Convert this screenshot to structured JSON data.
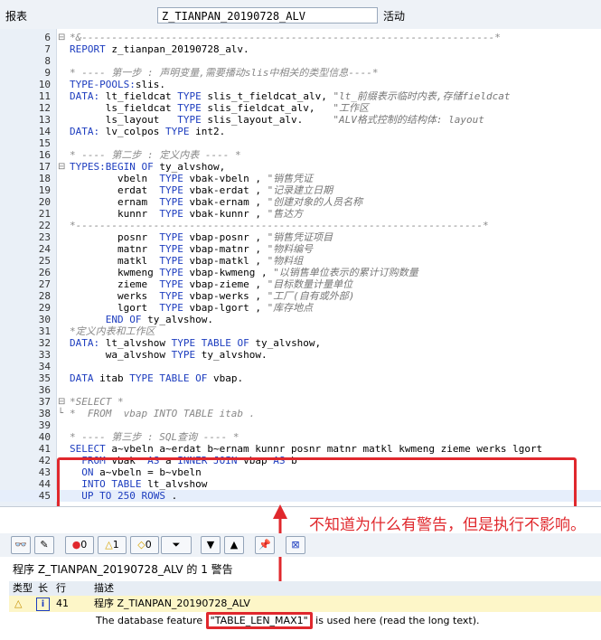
{
  "header": {
    "label": "报表",
    "program": "Z_TIANPAN_20190728_ALV",
    "status": "活动"
  },
  "code_lines": [
    {
      "n": "6",
      "fold": "⊟",
      "segs": [
        {
          "t": "*&---------------------------------------------------------------------*",
          "c": "cmt"
        }
      ]
    },
    {
      "n": "7",
      "segs": [
        {
          "t": "REPORT ",
          "c": "kw"
        },
        {
          "t": "z_tianpan_20190728_alv.",
          "c": ""
        }
      ]
    },
    {
      "n": "8",
      "segs": []
    },
    {
      "n": "9",
      "segs": [
        {
          "t": "* ---- 第一步 : 声明变量,需要播动slis中相关的类型信息----*",
          "c": "cmt"
        }
      ]
    },
    {
      "n": "10",
      "segs": [
        {
          "t": "TYPE-POOLS:",
          "c": "kw"
        },
        {
          "t": "slis.",
          "c": ""
        }
      ]
    },
    {
      "n": "11",
      "segs": [
        {
          "t": "DATA: ",
          "c": "kw"
        },
        {
          "t": "lt_fieldcat ",
          "c": ""
        },
        {
          "t": "TYPE ",
          "c": "kw"
        },
        {
          "t": "slis_t_fieldcat_alv, ",
          "c": ""
        },
        {
          "t": "\"lt_前缀表示临时内表,存储fieldcat",
          "c": "str"
        }
      ]
    },
    {
      "n": "12",
      "segs": [
        {
          "t": "      ls_fieldcat ",
          "c": ""
        },
        {
          "t": "TYPE ",
          "c": "kw"
        },
        {
          "t": "slis_fieldcat_alv,   ",
          "c": ""
        },
        {
          "t": "\"工作区",
          "c": "str"
        }
      ]
    },
    {
      "n": "13",
      "segs": [
        {
          "t": "      ls_layout   ",
          "c": ""
        },
        {
          "t": "TYPE ",
          "c": "kw"
        },
        {
          "t": "slis_layout_alv.     ",
          "c": ""
        },
        {
          "t": "\"ALV格式控制的结构体: layout",
          "c": "str"
        }
      ]
    },
    {
      "n": "14",
      "segs": [
        {
          "t": "DATA: ",
          "c": "kw"
        },
        {
          "t": "lv_colpos ",
          "c": ""
        },
        {
          "t": "TYPE ",
          "c": "kw"
        },
        {
          "t": "int2.",
          "c": ""
        }
      ]
    },
    {
      "n": "15",
      "segs": []
    },
    {
      "n": "16",
      "segs": [
        {
          "t": "* ---- 第二步 : 定义内表 ---- *",
          "c": "cmt"
        }
      ]
    },
    {
      "n": "17",
      "fold": "⊟",
      "segs": [
        {
          "t": "TYPES:BEGIN OF ",
          "c": "kw"
        },
        {
          "t": "ty_alvshow,",
          "c": ""
        }
      ]
    },
    {
      "n": "18",
      "segs": [
        {
          "t": "        vbeln  ",
          "c": ""
        },
        {
          "t": "TYPE ",
          "c": "kw"
        },
        {
          "t": "vbak-vbeln , ",
          "c": ""
        },
        {
          "t": "\"销售凭证",
          "c": "str"
        }
      ]
    },
    {
      "n": "19",
      "segs": [
        {
          "t": "        erdat  ",
          "c": ""
        },
        {
          "t": "TYPE ",
          "c": "kw"
        },
        {
          "t": "vbak-erdat , ",
          "c": ""
        },
        {
          "t": "\"记录建立日期",
          "c": "str"
        }
      ]
    },
    {
      "n": "20",
      "segs": [
        {
          "t": "        ernam  ",
          "c": ""
        },
        {
          "t": "TYPE ",
          "c": "kw"
        },
        {
          "t": "vbak-ernam , ",
          "c": ""
        },
        {
          "t": "\"创建对象的人员名称",
          "c": "str"
        }
      ]
    },
    {
      "n": "21",
      "segs": [
        {
          "t": "        kunnr  ",
          "c": ""
        },
        {
          "t": "TYPE ",
          "c": "kw"
        },
        {
          "t": "vbak-kunnr , ",
          "c": ""
        },
        {
          "t": "\"售达方",
          "c": "str"
        }
      ]
    },
    {
      "n": "22",
      "segs": [
        {
          "t": "*--------------------------------------------------------------------*",
          "c": "cmt"
        }
      ]
    },
    {
      "n": "23",
      "segs": [
        {
          "t": "        posnr  ",
          "c": ""
        },
        {
          "t": "TYPE ",
          "c": "kw"
        },
        {
          "t": "vbap-posnr , ",
          "c": ""
        },
        {
          "t": "\"销售凭证项目",
          "c": "str"
        }
      ]
    },
    {
      "n": "24",
      "segs": [
        {
          "t": "        matnr  ",
          "c": ""
        },
        {
          "t": "TYPE ",
          "c": "kw"
        },
        {
          "t": "vbap-matnr , ",
          "c": ""
        },
        {
          "t": "\"物料编号",
          "c": "str"
        }
      ]
    },
    {
      "n": "25",
      "segs": [
        {
          "t": "        matkl  ",
          "c": ""
        },
        {
          "t": "TYPE ",
          "c": "kw"
        },
        {
          "t": "vbap-matkl , ",
          "c": ""
        },
        {
          "t": "\"物料组",
          "c": "str"
        }
      ]
    },
    {
      "n": "26",
      "segs": [
        {
          "t": "        kwmeng ",
          "c": ""
        },
        {
          "t": "TYPE ",
          "c": "kw"
        },
        {
          "t": "vbap-kwmeng , ",
          "c": ""
        },
        {
          "t": "\"以销售单位表示的累计订购数量",
          "c": "str"
        }
      ]
    },
    {
      "n": "27",
      "segs": [
        {
          "t": "        zieme  ",
          "c": ""
        },
        {
          "t": "TYPE ",
          "c": "kw"
        },
        {
          "t": "vbap-zieme , ",
          "c": ""
        },
        {
          "t": "\"目标数量计量单位",
          "c": "str"
        }
      ]
    },
    {
      "n": "28",
      "segs": [
        {
          "t": "        werks  ",
          "c": ""
        },
        {
          "t": "TYPE ",
          "c": "kw"
        },
        {
          "t": "vbap-werks , ",
          "c": ""
        },
        {
          "t": "\"工厂(自有或外部)",
          "c": "str"
        }
      ]
    },
    {
      "n": "29",
      "segs": [
        {
          "t": "        lgort  ",
          "c": ""
        },
        {
          "t": "TYPE ",
          "c": "kw"
        },
        {
          "t": "vbap-lgort , ",
          "c": ""
        },
        {
          "t": "\"库存地点",
          "c": "str"
        }
      ]
    },
    {
      "n": "30",
      "segs": [
        {
          "t": "      END OF ",
          "c": "kw"
        },
        {
          "t": "ty_alvshow.",
          "c": ""
        }
      ]
    },
    {
      "n": "31",
      "segs": [
        {
          "t": "*定义内表和工作区",
          "c": "cmt"
        }
      ]
    },
    {
      "n": "32",
      "segs": [
        {
          "t": "DATA: ",
          "c": "kw"
        },
        {
          "t": "lt_alvshow ",
          "c": ""
        },
        {
          "t": "TYPE TABLE OF ",
          "c": "kw"
        },
        {
          "t": "ty_alvshow,",
          "c": ""
        }
      ]
    },
    {
      "n": "33",
      "segs": [
        {
          "t": "      wa_alvshow ",
          "c": ""
        },
        {
          "t": "TYPE ",
          "c": "kw"
        },
        {
          "t": "ty_alvshow.",
          "c": ""
        }
      ]
    },
    {
      "n": "34",
      "segs": []
    },
    {
      "n": "35",
      "segs": [
        {
          "t": "DATA ",
          "c": "kw"
        },
        {
          "t": "itab ",
          "c": ""
        },
        {
          "t": "TYPE TABLE OF ",
          "c": "kw"
        },
        {
          "t": "vbap.",
          "c": ""
        }
      ]
    },
    {
      "n": "36",
      "segs": []
    },
    {
      "n": "37",
      "fold": "⊟",
      "segs": [
        {
          "t": "*SELECT *",
          "c": "cmt"
        }
      ]
    },
    {
      "n": "38",
      "fold": "└",
      "segs": [
        {
          "t": "*  FROM  vbap INTO TABLE itab .",
          "c": "cmt"
        }
      ]
    },
    {
      "n": "39",
      "segs": []
    },
    {
      "n": "40",
      "segs": [
        {
          "t": "* ---- 第三步 : SQL查询 ---- *",
          "c": "cmt"
        }
      ]
    },
    {
      "n": "41",
      "segs": [
        {
          "t": "SELECT ",
          "c": "kw"
        },
        {
          "t": "a~vbeln a~erdat b~ernam kunnr posnr matnr matkl kwmeng zieme werks lgort",
          "c": ""
        }
      ]
    },
    {
      "n": "42",
      "segs": [
        {
          "t": "  FROM ",
          "c": "kw"
        },
        {
          "t": "vbak  ",
          "c": ""
        },
        {
          "t": "AS ",
          "c": "kw"
        },
        {
          "t": "a ",
          "c": ""
        },
        {
          "t": "INNER JOIN ",
          "c": "kw"
        },
        {
          "t": "vbap ",
          "c": ""
        },
        {
          "t": "AS ",
          "c": "kw"
        },
        {
          "t": "b",
          "c": ""
        }
      ]
    },
    {
      "n": "43",
      "segs": [
        {
          "t": "  ON ",
          "c": "kw"
        },
        {
          "t": "a~vbeln = b~vbeln",
          "c": ""
        }
      ]
    },
    {
      "n": "44",
      "segs": [
        {
          "t": "  INTO TABLE ",
          "c": "kw"
        },
        {
          "t": "lt_alvshow",
          "c": ""
        }
      ]
    },
    {
      "n": "45",
      "hl": true,
      "segs": [
        {
          "t": "  UP TO ",
          "c": "kw"
        },
        {
          "t": "250 ",
          "c": "kw"
        },
        {
          "t": "ROWS ",
          "c": "kw"
        },
        {
          "t": ".",
          "c": ""
        }
      ]
    }
  ],
  "toolbar": {
    "stop_count": "0",
    "warn_count": "1",
    "info_count": "0"
  },
  "messages": {
    "title": "程序 Z_TIANPAN_20190728_ALV 的 1 警告",
    "headers": {
      "type": "类型",
      "long": "长",
      "line": "行",
      "desc": "描述"
    },
    "row": {
      "line": "41",
      "desc": "程序 Z_TIANPAN_20190728_ALV"
    },
    "detail_pre": "The database feature ",
    "detail_feature": "\"TABLE_LEN_MAX1\"",
    "detail_post": " is used here (read the long text)."
  },
  "annotation": "不知道为什么有警告，但是执行不影响。",
  "colors": {
    "keyword": "#1d3dbf",
    "comment": "#888888",
    "highlight": "#e6eefb",
    "annotation": "#e0282d",
    "warning_row": "#fdf6c8"
  }
}
